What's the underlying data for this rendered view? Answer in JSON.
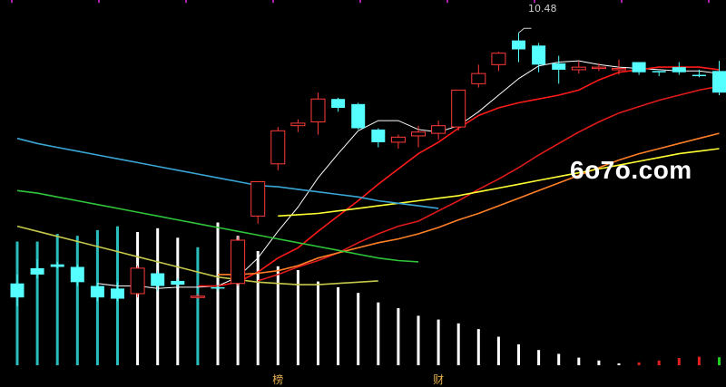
{
  "chart_data": {
    "type": "candlestick",
    "max_label": "10.48",
    "price_scale": {
      "min": 8.33,
      "max": 10.56
    },
    "colors": {
      "up": "#ff3a3a",
      "down": "#55ffff",
      "ma5": "#ffffff",
      "ma10": "#ff1a1a",
      "ma20": "#e01a1a",
      "ma30": "#ff7f27",
      "ma60": "#ffff33",
      "ma_long_a": "#3aa6d6",
      "ma_long_b": "#2fc43a",
      "ma_long_c": "#c4c84a",
      "bar_white": "#ffffff",
      "bar_cyan": "#2bbdbd",
      "bar_red": "#e02020",
      "bar_green": "#22cc22"
    },
    "candles": [
      {
        "o": 8.51,
        "h": 8.58,
        "l": 8.33,
        "c": 8.4
      },
      {
        "o": 8.63,
        "h": 8.7,
        "l": 8.55,
        "c": 8.58
      },
      {
        "o": 8.66,
        "h": 8.68,
        "l": 8.63,
        "c": 8.64
      },
      {
        "o": 8.64,
        "h": 8.66,
        "l": 8.49,
        "c": 8.52
      },
      {
        "o": 8.49,
        "h": 8.51,
        "l": 8.37,
        "c": 8.4
      },
      {
        "o": 8.47,
        "h": 8.52,
        "l": 8.37,
        "c": 8.39
      },
      {
        "o": 8.43,
        "h": 8.65,
        "l": 8.4,
        "c": 8.63
      },
      {
        "o": 8.59,
        "h": 8.61,
        "l": 8.45,
        "c": 8.49
      },
      {
        "o": 8.53,
        "h": 8.55,
        "l": 8.48,
        "c": 8.5
      },
      {
        "o": 8.41,
        "h": 8.43,
        "l": 8.39,
        "c": 8.41
      },
      {
        "o": 8.48,
        "h": 8.5,
        "l": 8.45,
        "c": 8.47
      },
      {
        "o": 8.51,
        "h": 8.88,
        "l": 8.49,
        "c": 8.85
      },
      {
        "o": 9.04,
        "h": 9.31,
        "l": 8.98,
        "c": 9.31
      },
      {
        "o": 9.45,
        "h": 9.74,
        "l": 9.4,
        "c": 9.71
      },
      {
        "o": 9.75,
        "h": 9.8,
        "l": 9.7,
        "c": 9.77
      },
      {
        "o": 9.78,
        "h": 10.01,
        "l": 9.68,
        "c": 9.96
      },
      {
        "o": 9.96,
        "h": 9.97,
        "l": 9.86,
        "c": 9.89
      },
      {
        "o": 9.92,
        "h": 9.93,
        "l": 9.72,
        "c": 9.73
      },
      {
        "o": 9.72,
        "h": 9.73,
        "l": 9.58,
        "c": 9.62
      },
      {
        "o": 9.62,
        "h": 9.68,
        "l": 9.57,
        "c": 9.66
      },
      {
        "o": 9.67,
        "h": 9.75,
        "l": 9.58,
        "c": 9.7
      },
      {
        "o": 9.69,
        "h": 9.79,
        "l": 9.64,
        "c": 9.75
      },
      {
        "o": 9.74,
        "h": 10.03,
        "l": 9.71,
        "c": 10.03
      },
      {
        "o": 10.08,
        "h": 10.23,
        "l": 10.05,
        "c": 10.16
      },
      {
        "o": 10.23,
        "h": 10.33,
        "l": 10.18,
        "c": 10.32
      },
      {
        "o": 10.42,
        "h": 10.48,
        "l": 10.25,
        "c": 10.35
      },
      {
        "o": 10.38,
        "h": 10.4,
        "l": 10.17,
        "c": 10.23
      },
      {
        "o": 10.24,
        "h": 10.3,
        "l": 10.08,
        "c": 10.19
      },
      {
        "o": 10.19,
        "h": 10.26,
        "l": 10.16,
        "c": 10.21
      },
      {
        "o": 10.21,
        "h": 10.24,
        "l": 10.18,
        "c": 10.21
      },
      {
        "o": 10.2,
        "h": 10.27,
        "l": 10.15,
        "c": 10.2
      },
      {
        "o": 10.25,
        "h": 10.25,
        "l": 10.15,
        "c": 10.17
      },
      {
        "o": 10.18,
        "h": 10.18,
        "l": 10.14,
        "c": 10.17
      },
      {
        "o": 10.21,
        "h": 10.25,
        "l": 10.15,
        "c": 10.17
      },
      {
        "o": 10.15,
        "h": 10.19,
        "l": 10.13,
        "c": 10.14
      },
      {
        "o": 10.18,
        "h": 10.26,
        "l": 9.99,
        "c": 10.01
      }
    ],
    "ma_lines": [
      {
        "key": "ma5",
        "values": [
          null,
          null,
          null,
          null,
          8.51,
          8.49,
          8.49,
          8.47,
          8.48,
          8.48,
          8.49,
          8.56,
          8.71,
          8.92,
          9.11,
          9.34,
          9.53,
          9.71,
          9.79,
          9.79,
          9.72,
          9.7,
          9.75,
          9.86,
          9.99,
          10.12,
          10.22,
          10.25,
          10.26,
          10.23,
          10.21,
          10.2,
          10.19,
          10.18,
          10.18,
          10.16
        ]
      },
      {
        "key": "ma10",
        "values": [
          null,
          null,
          null,
          null,
          null,
          null,
          null,
          null,
          null,
          8.49,
          8.49,
          8.52,
          8.6,
          8.71,
          8.79,
          8.92,
          9.04,
          9.16,
          9.29,
          9.41,
          9.53,
          9.62,
          9.73,
          9.83,
          9.89,
          9.93,
          9.96,
          9.99,
          10.03,
          10.11,
          10.17,
          10.19,
          10.21,
          10.21,
          10.21,
          10.19
        ]
      },
      {
        "key": "ma20",
        "values": [
          null,
          null,
          null,
          null,
          null,
          null,
          null,
          null,
          null,
          null,
          null,
          null,
          8.53,
          8.58,
          8.64,
          8.69,
          8.75,
          8.83,
          8.9,
          8.96,
          9.0,
          9.08,
          9.16,
          9.25,
          9.33,
          9.42,
          9.52,
          9.61,
          9.7,
          9.78,
          9.85,
          9.9,
          9.95,
          9.99,
          10.03,
          10.06
        ]
      },
      {
        "key": "ma30",
        "values": [
          null,
          null,
          null,
          null,
          null,
          null,
          null,
          null,
          null,
          null,
          8.58,
          8.58,
          8.59,
          8.61,
          8.65,
          8.71,
          8.75,
          8.79,
          8.83,
          8.86,
          8.9,
          8.95,
          9.01,
          9.06,
          9.12,
          9.18,
          9.24,
          9.3,
          9.36,
          9.42,
          9.48,
          9.53,
          9.57,
          9.61,
          9.65,
          9.69
        ]
      },
      {
        "key": "ma60",
        "values": [
          null,
          null,
          null,
          null,
          null,
          null,
          null,
          null,
          null,
          null,
          null,
          null,
          null,
          9.04,
          9.05,
          9.06,
          9.08,
          9.1,
          9.12,
          9.14,
          9.16,
          9.18,
          9.2,
          9.23,
          9.26,
          9.29,
          9.32,
          9.35,
          9.38,
          9.41,
          9.44,
          9.47,
          9.5,
          9.53,
          9.55,
          9.57
        ]
      },
      {
        "key": "ma_long_a",
        "values": [
          9.65,
          9.61,
          9.58,
          9.55,
          9.52,
          9.49,
          9.46,
          9.43,
          9.4,
          9.37,
          9.34,
          9.31,
          9.28,
          9.27,
          9.25,
          9.23,
          9.21,
          9.19,
          9.16,
          9.14,
          9.12,
          9.1
        ]
      },
      {
        "key": "ma_long_b",
        "values": [
          9.24,
          9.22,
          9.19,
          9.16,
          9.13,
          9.1,
          9.07,
          9.04,
          9.01,
          8.98,
          8.95,
          8.92,
          8.89,
          8.86,
          8.83,
          8.8,
          8.77,
          8.74,
          8.71,
          8.69,
          8.68
        ]
      },
      {
        "key": "ma_long_c",
        "values": [
          8.96,
          8.92,
          8.88,
          8.84,
          8.8,
          8.76,
          8.72,
          8.68,
          8.64,
          8.6,
          8.56,
          8.54,
          8.52,
          8.51,
          8.5,
          8.5,
          8.51,
          8.52,
          8.53
        ]
      }
    ],
    "indicator_bars": [
      {
        "v": 0.65,
        "c": "cyan"
      },
      {
        "v": 0.65,
        "c": "cyan"
      },
      {
        "v": 0.69,
        "c": "cyan"
      },
      {
        "v": 0.68,
        "c": "cyan"
      },
      {
        "v": 0.71,
        "c": "cyan"
      },
      {
        "v": 0.73,
        "c": "cyan"
      },
      {
        "v": 0.7,
        "c": "white"
      },
      {
        "v": 0.72,
        "c": "white"
      },
      {
        "v": 0.67,
        "c": "white"
      },
      {
        "v": 0.62,
        "c": "cyan"
      },
      {
        "v": 0.75,
        "c": "white"
      },
      {
        "v": 0.68,
        "c": "white"
      },
      {
        "v": 0.6,
        "c": "white"
      },
      {
        "v": 0.52,
        "c": "white"
      },
      {
        "v": 0.5,
        "c": "white"
      },
      {
        "v": 0.44,
        "c": "white"
      },
      {
        "v": 0.41,
        "c": "white"
      },
      {
        "v": 0.38,
        "c": "white"
      },
      {
        "v": 0.33,
        "c": "white"
      },
      {
        "v": 0.3,
        "c": "white"
      },
      {
        "v": 0.26,
        "c": "white"
      },
      {
        "v": 0.24,
        "c": "white"
      },
      {
        "v": 0.22,
        "c": "white"
      },
      {
        "v": 0.19,
        "c": "white"
      },
      {
        "v": 0.15,
        "c": "white"
      },
      {
        "v": 0.11,
        "c": "white"
      },
      {
        "v": 0.08,
        "c": "white"
      },
      {
        "v": 0.06,
        "c": "white"
      },
      {
        "v": 0.04,
        "c": "white"
      },
      {
        "v": 0.025,
        "c": "white"
      },
      {
        "v": 0.01,
        "c": "white"
      },
      {
        "v": 0.015,
        "c": "red"
      },
      {
        "v": 0.025,
        "c": "red"
      },
      {
        "v": 0.038,
        "c": "red"
      },
      {
        "v": 0.045,
        "c": "red"
      },
      {
        "v": 0.042,
        "c": "green"
      }
    ],
    "markers": [
      {
        "text": "榜",
        "index": 13
      },
      {
        "text": "财",
        "index": 21
      }
    ]
  },
  "watermark": "6o7o.com"
}
